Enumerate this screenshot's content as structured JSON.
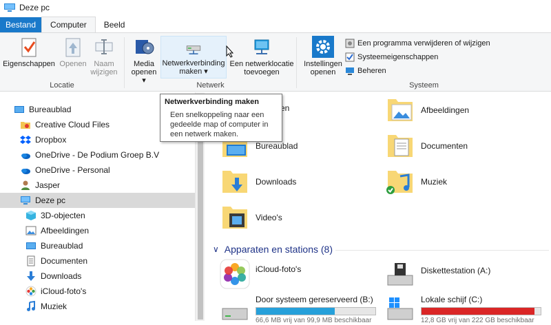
{
  "window": {
    "title": "Deze pc"
  },
  "tabs": {
    "file": "Bestand",
    "computer": "Computer",
    "view": "Beeld"
  },
  "ribbon": {
    "locatie": {
      "label": "Locatie",
      "eigenschappen": "Eigenschappen",
      "openen": "Openen",
      "naam_wijzigen_1": "Naam",
      "naam_wijzigen_2": "wijzigen"
    },
    "netwerk": {
      "label": "Netwerk",
      "media_1": "Media",
      "media_2": "openen",
      "netwerkverbinding_1": "Netwerkverbinding",
      "netwerkverbinding_2": "maken",
      "netwerklocatie_1": "Een netwerklocatie",
      "netwerklocatie_2": "toevoegen",
      "dropdown_arrow": "▾"
    },
    "systeem": {
      "label": "Systeem",
      "instellingen_1": "Instellingen",
      "instellingen_2": "openen",
      "programma_verwijderen": "Een programma verwijderen of wijzigen",
      "systeemeigenschappen": "Systeemeigenschappen",
      "beheren": "Beheren"
    }
  },
  "tooltip": {
    "title": "Netwerkverbinding maken",
    "body": "Een snelkoppeling naar een gedeelde map of computer in een netwerk maken."
  },
  "nav": [
    {
      "label": "Bureaublad",
      "icon": "desktop-icon"
    },
    {
      "label": "Creative Cloud Files",
      "icon": "creative-cloud-icon"
    },
    {
      "label": "Dropbox",
      "icon": "dropbox-icon"
    },
    {
      "label": "OneDrive - De Podium Groep B.V",
      "icon": "onedrive-icon"
    },
    {
      "label": "OneDrive - Personal",
      "icon": "onedrive-icon"
    },
    {
      "label": "Jasper",
      "icon": "user-icon"
    },
    {
      "label": "Deze pc",
      "icon": "pc-icon",
      "selected": true
    },
    {
      "label": "3D-objecten",
      "icon": "3d-objects-icon"
    },
    {
      "label": "Afbeeldingen",
      "icon": "pictures-icon"
    },
    {
      "label": "Bureaublad",
      "icon": "desktop-icon"
    },
    {
      "label": "Documenten",
      "icon": "documents-icon"
    },
    {
      "label": "Downloads",
      "icon": "downloads-icon"
    },
    {
      "label": "iCloud-foto's",
      "icon": "icloud-photos-icon"
    },
    {
      "label": "Muziek",
      "icon": "music-icon"
    }
  ],
  "folders": {
    "partial": "nten",
    "afbeeldingen": "Afbeeldingen",
    "bureaublad": "Bureaublad",
    "documenten": "Documenten",
    "downloads": "Downloads",
    "muziek": "Muziek",
    "videos": "Video's"
  },
  "devices": {
    "header": "Apparaten en stations (8)",
    "icloud": "iCloud-foto's",
    "diskette": "Diskettestation (A:)",
    "reserved": {
      "label": "Door systeem gereserveerd (B:)",
      "fill_fraction": 0.66,
      "fill_color": "#26a0da",
      "free_text": "66,6 MB vrij van 99,9 MB beschikbaar"
    },
    "local": {
      "label": "Lokale schijf (C:)",
      "fill_fraction": 0.95,
      "fill_color": "#da2626",
      "free_text": "12,8 GB vrij van 222 GB beschikbaar"
    }
  },
  "colors": {
    "accent": "#1979ca",
    "folder": "#f8d775"
  }
}
